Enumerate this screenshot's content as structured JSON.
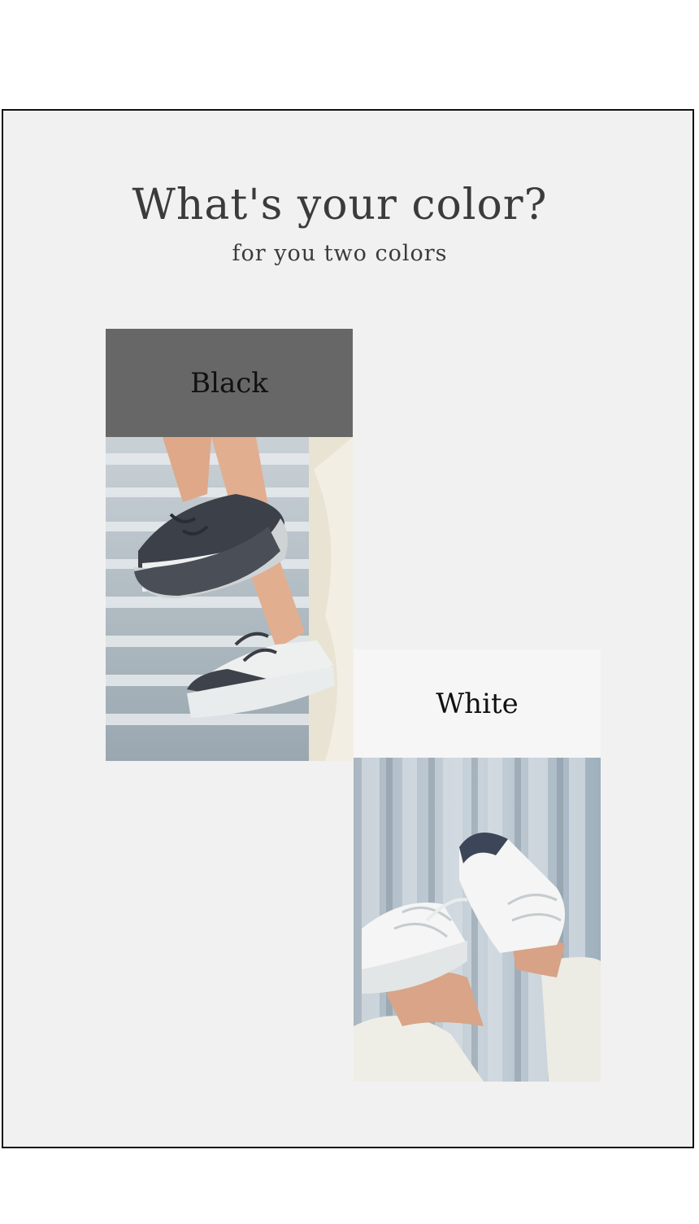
{
  "header": {
    "title": "What's your color?",
    "subtitle": "for you two colors"
  },
  "variants": [
    {
      "label": "Black",
      "swatch_color": "#676767"
    },
    {
      "label": "White",
      "swatch_color": "#f6f6f6"
    }
  ]
}
